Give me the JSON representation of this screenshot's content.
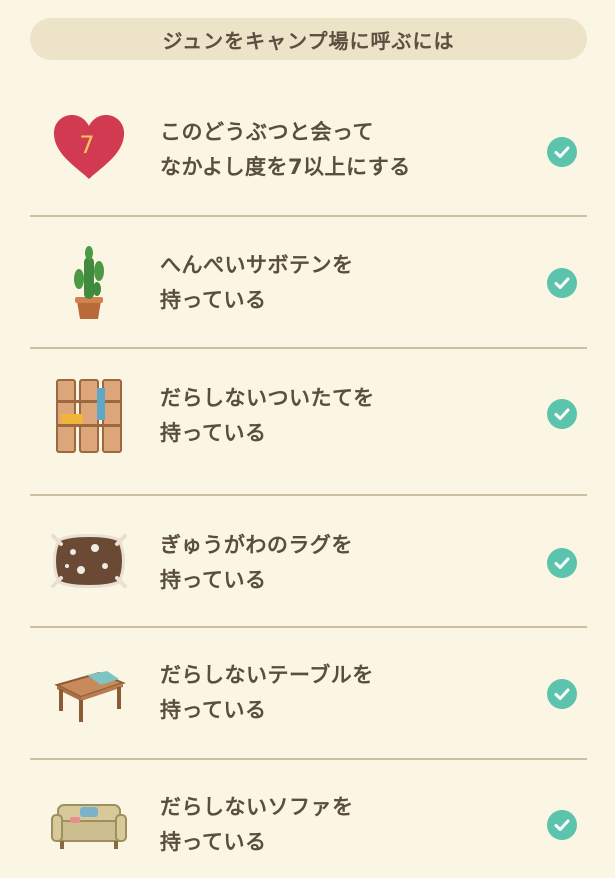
{
  "header": {
    "title": "ジュンをキャンプ場に呼ぶには"
  },
  "conditions": [
    {
      "icon": "heart-icon",
      "badge": "7",
      "line1": "このどうぶつと会って",
      "line2": "なかよし度を7以上にする",
      "completed": true
    },
    {
      "icon": "cactus-icon",
      "line1": "へんぺいサボテンを",
      "line2": "持っている",
      "completed": true
    },
    {
      "icon": "partition-screen-icon",
      "line1": "だらしないついたてを",
      "line2": "持っている",
      "completed": true
    },
    {
      "icon": "rug-icon",
      "line1": "ぎゅうがわのラグを",
      "line2": "持っている",
      "completed": true
    },
    {
      "icon": "table-icon",
      "line1": "だらしないテーブルを",
      "line2": "持っている",
      "completed": true
    },
    {
      "icon": "sofa-icon",
      "line1": "だらしないソファを",
      "line2": "持っている",
      "completed": true
    }
  ],
  "colors": {
    "background": "#faf6e3",
    "header_bg": "#ece3c8",
    "check": "#5cc3ad",
    "heart": "#d23a52",
    "divider": "#cdbf9f"
  }
}
